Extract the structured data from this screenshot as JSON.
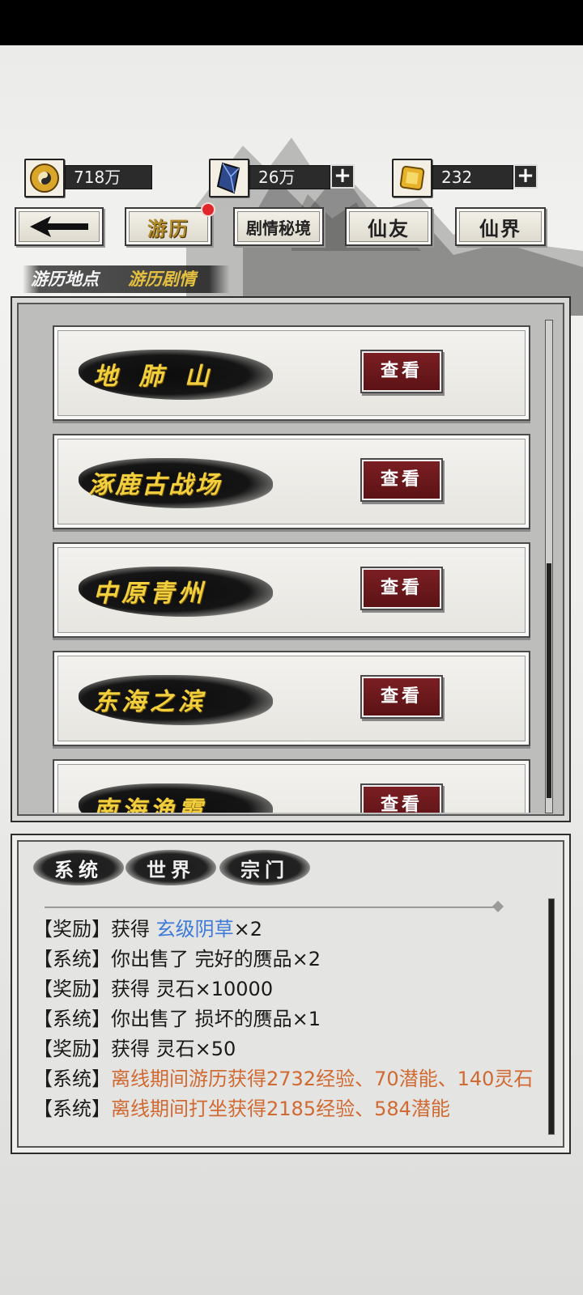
{
  "currencies": [
    {
      "icon": "bagua-coin-icon",
      "value": "718万",
      "has_plus": false
    },
    {
      "icon": "blue-crystal-icon",
      "value": "26万",
      "has_plus": true
    },
    {
      "icon": "gold-ingot-icon",
      "value": "232",
      "has_plus": true
    }
  ],
  "plus_label": "+",
  "nav": {
    "back_icon": "back-arrow-icon",
    "tabs": [
      {
        "label": "游历",
        "active": true,
        "badge": true
      },
      {
        "label": "剧情秘境",
        "active": false
      },
      {
        "label": "仙友",
        "active": false
      },
      {
        "label": "仙界",
        "active": false
      }
    ]
  },
  "subtabs": [
    "游历地点",
    "游历剧情"
  ],
  "locations": [
    {
      "name": "地 肺 山",
      "button": "查看"
    },
    {
      "name": "涿鹿古战场",
      "button": "查看"
    },
    {
      "name": "中原青州",
      "button": "查看"
    },
    {
      "name": "东海之滨",
      "button": "查看"
    },
    {
      "name": "南海渔霞",
      "button": "查看"
    }
  ],
  "chat": {
    "tabs": [
      {
        "label": "系统",
        "active": true
      },
      {
        "label": "世界",
        "active": false
      },
      {
        "label": "宗门",
        "active": false
      }
    ],
    "messages": [
      {
        "prefix": "【奖励】获得 ",
        "highlight": "玄级阴草",
        "suffix": "×2",
        "style": "blue"
      },
      {
        "prefix": "【系统】你出售了 完好的赝品×2",
        "highlight": "",
        "suffix": "",
        "style": "plain"
      },
      {
        "prefix": "【奖励】获得 灵石×10000",
        "highlight": "",
        "suffix": "",
        "style": "plain"
      },
      {
        "prefix": "【系统】你出售了 损坏的赝品×1",
        "highlight": "",
        "suffix": "",
        "style": "plain"
      },
      {
        "prefix": "【奖励】获得 灵石×50",
        "highlight": "",
        "suffix": "",
        "style": "plain"
      },
      {
        "prefix": "【系统】",
        "highlight": "离线期间游历获得2732经验、70潜能、140灵石",
        "suffix": "",
        "style": "orange"
      },
      {
        "prefix": "【系统】",
        "highlight": "离线期间打坐获得2185经验、584潜能",
        "suffix": "",
        "style": "orange"
      }
    ]
  },
  "colors": {
    "accent_gold": "#f2cf3c",
    "button_red": "#6e191d",
    "link_blue": "#3d7ad9",
    "system_orange": "#d16a32"
  }
}
